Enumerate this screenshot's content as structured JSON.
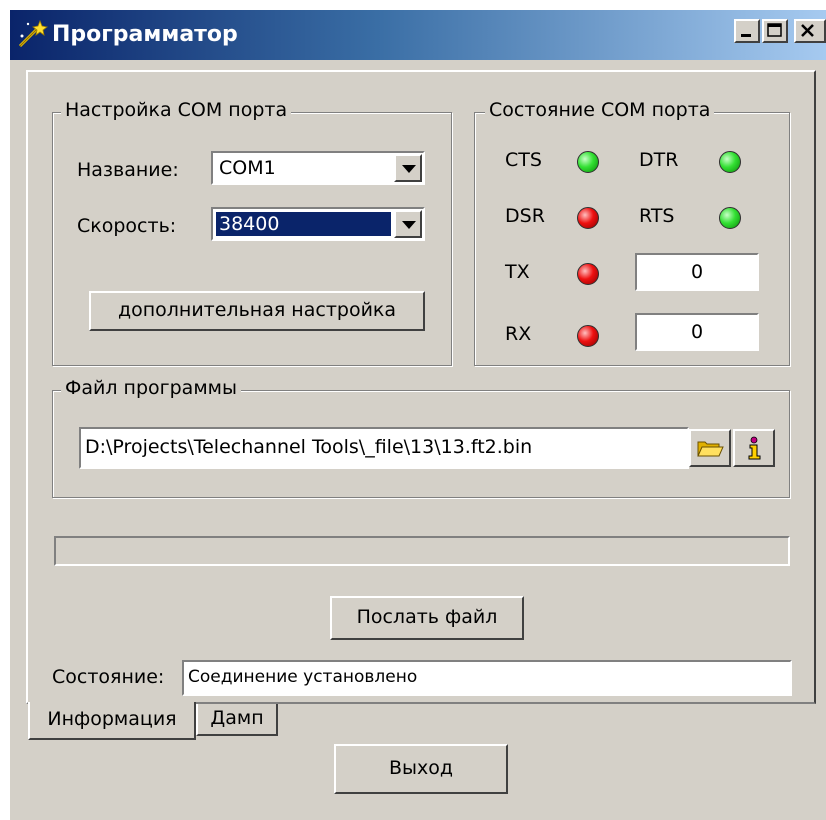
{
  "window": {
    "title": "Программатор",
    "controls": [
      "minimize",
      "maximize",
      "close"
    ],
    "title_gradient": [
      "#0a246a",
      "#a6caf0"
    ]
  },
  "com_settings": {
    "legend": "Настройка COM порта",
    "name_label": "Название:",
    "name_value": "COM1",
    "speed_label": "Скорость:",
    "speed_value": "38400",
    "advanced_button": "дополнительная настройка"
  },
  "com_state": {
    "legend": "Состояние COM порта",
    "cts_label": "CTS",
    "cts_state": "green",
    "dtr_label": "DTR",
    "dtr_state": "green",
    "dsr_label": "DSR",
    "dsr_state": "red",
    "rts_label": "RTS",
    "rts_state": "green",
    "tx_label": "TX",
    "tx_state": "red",
    "tx_count": "0",
    "rx_label": "RX",
    "rx_state": "red",
    "rx_count": "0"
  },
  "program_file": {
    "legend": "Файл программы",
    "path": "D:\\Projects\\Telechannel Tools\\_file\\13\\13.ft2.bin",
    "browse_icon": "folder-icon",
    "info_icon": "info-icon"
  },
  "progress": 0,
  "send_button": "Послать файл",
  "status": {
    "label": "Состояние:",
    "value": "Соединение установлено"
  },
  "tabs": [
    {
      "label": "Информация",
      "active": true
    },
    {
      "label": "Дамп",
      "active": false
    }
  ],
  "exit_button": "Выход",
  "colors": {
    "face": "#d4d0c8",
    "selection": "#0a246a",
    "led_green": "#33e033",
    "led_red": "#ee1111"
  }
}
